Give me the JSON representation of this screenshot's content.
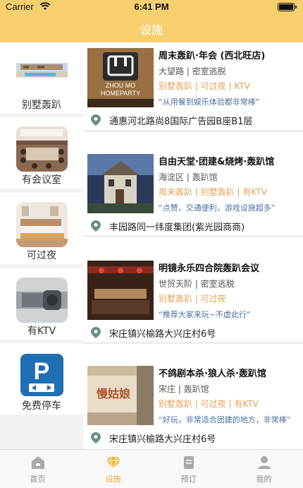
{
  "status_bar": {
    "carrier": "Carrier",
    "time": "6:41 PM"
  },
  "header": {
    "title": "设施"
  },
  "sidebar": {
    "items": [
      {
        "label": "别墅轰趴",
        "icon": "villa-pool-image"
      },
      {
        "label": "有会议室",
        "icon": "meeting-room-image"
      },
      {
        "label": "可过夜",
        "icon": "bedroom-image"
      },
      {
        "label": "有KTV",
        "icon": "microphone-image"
      },
      {
        "label": "免费停车",
        "icon": "parking-sign-image"
      }
    ]
  },
  "venues": [
    {
      "title": "周末轰趴·年会 (西北旺店)",
      "meta": "大望路 | 密室逃脱",
      "tags": "别墅轰趴 | 可过夜 | KTV",
      "quote": "“从用餐到娱乐体验都非常棒”",
      "address": "通惠河北路尚8国际广告园B座B1层",
      "photo_text": [
        "ZHOU MO",
        "HOMEPARTY"
      ]
    },
    {
      "title": "自由天堂·团建&烧烤·轰趴馆",
      "meta": "海淀区 | 轰趴馆",
      "tags": "周末轰趴 | 别墅轰趴 | 有KTV",
      "quote": "“点赞，交通便利，游戏设施超多”",
      "address": "丰园路同一纬度集团(紫光园商商)",
      "photo_text": []
    },
    {
      "title": "明镜永乐四合院轰趴会议",
      "meta": "世贸天阶 | 密室逃脱",
      "tags": "别墅轰趴 | 可过夜",
      "quote": "“推荐大家来玩~不虚此行”",
      "address": "宋庄镇兴榆路大兴庄村6号",
      "photo_text": []
    },
    {
      "title": "不鸽剧本杀·狼人杀·轰趴馆",
      "meta": "宋庄 | 轰趴馆",
      "tags": "别墅轰趴 | 可过夜 | 有KTV",
      "quote": "“好玩，非常适合团建的地方，非常棒”",
      "address": "宋庄镇兴榆路大兴庄村6号",
      "photo_text": [
        "慢姑娘"
      ]
    }
  ],
  "tabbar": {
    "items": [
      {
        "label": "首页",
        "icon": "home-icon",
        "active": false
      },
      {
        "label": "设施",
        "icon": "diamond-icon",
        "active": true
      },
      {
        "label": "预订",
        "icon": "booking-icon",
        "active": false
      },
      {
        "label": "我的",
        "icon": "user-icon",
        "active": false
      }
    ]
  },
  "colors": {
    "header": "#f6cf6f",
    "accent": "#e8a93a",
    "tag": "#e3a35a",
    "quote": "#4a6ea0",
    "pin": "#6a8f8a"
  }
}
